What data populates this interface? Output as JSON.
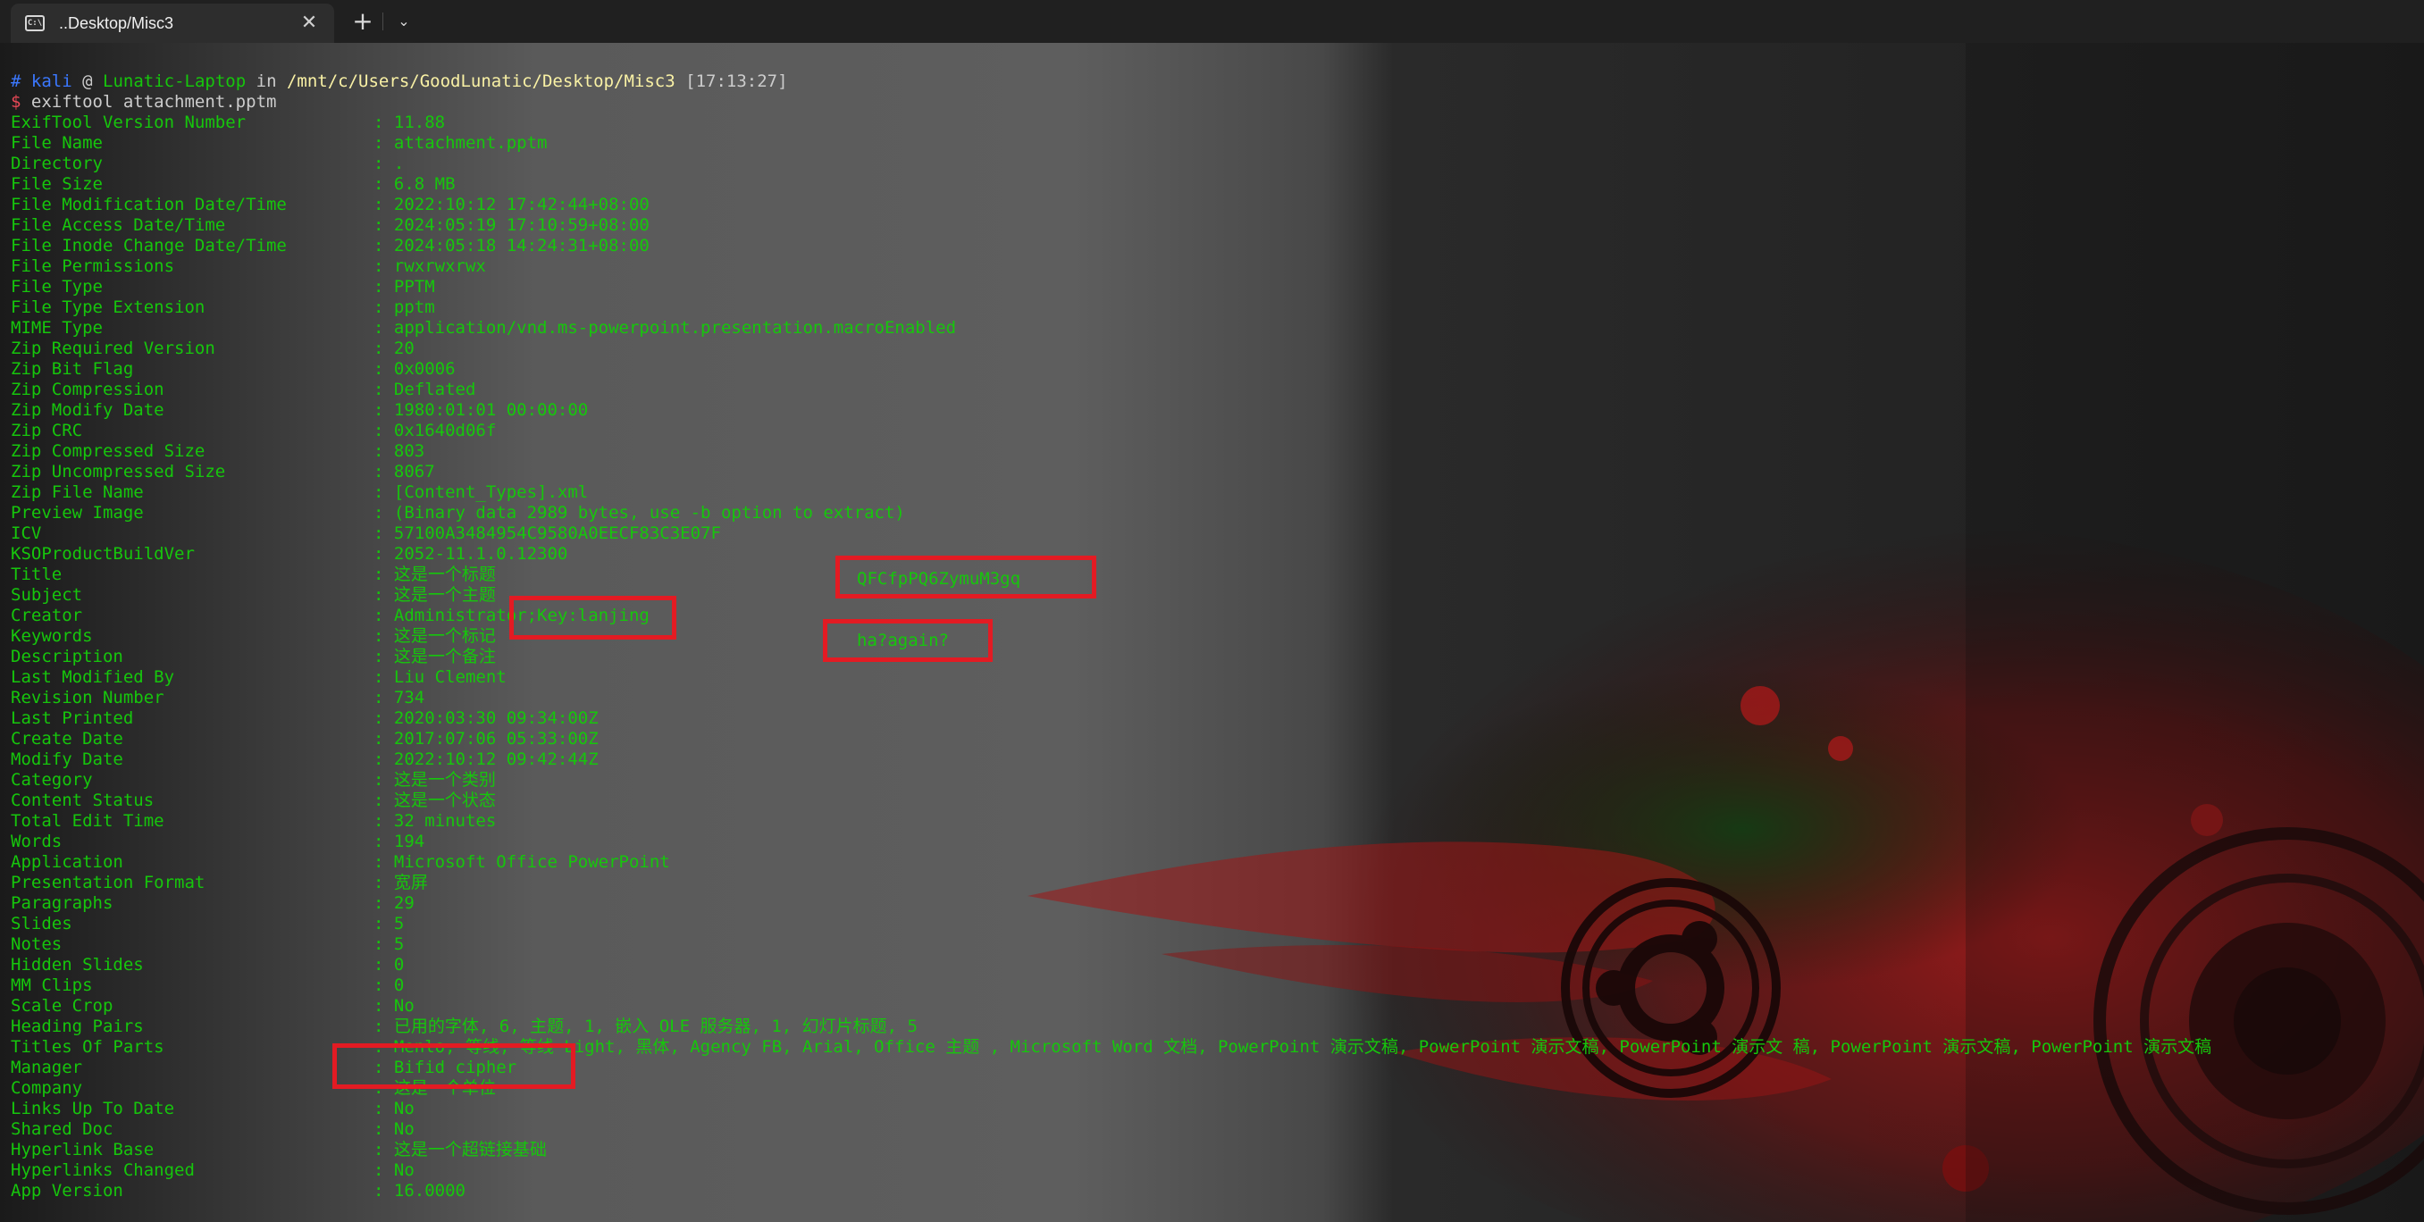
{
  "tab": {
    "title": "..Desktop/Misc3",
    "icon": "terminal-icon",
    "close_glyph": "✕",
    "new_tab_glyph": "+",
    "dropdown_glyph": "⌄"
  },
  "prompt": {
    "hash": "#",
    "user": "kali",
    "at": "@",
    "host": "Lunatic-Laptop",
    "in": "in",
    "path": "/mnt/c/Users/GoodLunatic/Desktop/Misc3",
    "time": "[17:13:27]",
    "dollar": "$",
    "command": "exiftool attachment.pptm"
  },
  "exif": [
    {
      "key": "ExifTool Version Number",
      "value": "11.88"
    },
    {
      "key": "File Name",
      "value": "attachment.pptm"
    },
    {
      "key": "Directory",
      "value": "."
    },
    {
      "key": "File Size",
      "value": "6.8 MB"
    },
    {
      "key": "File Modification Date/Time",
      "value": "2022:10:12 17:42:44+08:00"
    },
    {
      "key": "File Access Date/Time",
      "value": "2024:05:19 17:10:59+08:00"
    },
    {
      "key": "File Inode Change Date/Time",
      "value": "2024:05:18 14:24:31+08:00"
    },
    {
      "key": "File Permissions",
      "value": "rwxrwxrwx"
    },
    {
      "key": "File Type",
      "value": "PPTM"
    },
    {
      "key": "File Type Extension",
      "value": "pptm"
    },
    {
      "key": "MIME Type",
      "value": "application/vnd.ms-powerpoint.presentation.macroEnabled"
    },
    {
      "key": "Zip Required Version",
      "value": "20"
    },
    {
      "key": "Zip Bit Flag",
      "value": "0x0006"
    },
    {
      "key": "Zip Compression",
      "value": "Deflated"
    },
    {
      "key": "Zip Modify Date",
      "value": "1980:01:01 00:00:00"
    },
    {
      "key": "Zip CRC",
      "value": "0x1640d06f"
    },
    {
      "key": "Zip Compressed Size",
      "value": "803"
    },
    {
      "key": "Zip Uncompressed Size",
      "value": "8067"
    },
    {
      "key": "Zip File Name",
      "value": "[Content_Types].xml"
    },
    {
      "key": "Preview Image",
      "value": "(Binary data 2989 bytes, use -b option to extract)"
    },
    {
      "key": "ICV",
      "value": "57100A3484954C9580A0EECF83C3E07F"
    },
    {
      "key": "KSOProductBuildVer",
      "value": "2052-11.1.0.12300"
    },
    {
      "key": "Title",
      "value": "这是一个标题"
    },
    {
      "key": "Subject",
      "value": "这是一个主题"
    },
    {
      "key": "Creator",
      "value": "Administrator;Key:lanjing"
    },
    {
      "key": "Keywords",
      "value": "这是一个标记"
    },
    {
      "key": "Description",
      "value": "这是一个备注"
    },
    {
      "key": "Last Modified By",
      "value": "Liu Clement"
    },
    {
      "key": "Revision Number",
      "value": "734"
    },
    {
      "key": "Last Printed",
      "value": "2020:03:30 09:34:00Z"
    },
    {
      "key": "Create Date",
      "value": "2017:07:06 05:33:00Z"
    },
    {
      "key": "Modify Date",
      "value": "2022:10:12 09:42:44Z"
    },
    {
      "key": "Category",
      "value": "这是一个类别"
    },
    {
      "key": "Content Status",
      "value": "这是一个状态"
    },
    {
      "key": "Total Edit Time",
      "value": "32 minutes"
    },
    {
      "key": "Words",
      "value": "194"
    },
    {
      "key": "Application",
      "value": "Microsoft Office PowerPoint"
    },
    {
      "key": "Presentation Format",
      "value": "宽屏"
    },
    {
      "key": "Paragraphs",
      "value": "29"
    },
    {
      "key": "Slides",
      "value": "5"
    },
    {
      "key": "Notes",
      "value": "5"
    },
    {
      "key": "Hidden Slides",
      "value": "0"
    },
    {
      "key": "MM Clips",
      "value": "0"
    },
    {
      "key": "Scale Crop",
      "value": "No"
    },
    {
      "key": "Heading Pairs",
      "value": "已用的字体, 6, 主题, 1, 嵌入 OLE 服务器, 1, 幻灯片标题, 5"
    },
    {
      "key": "Titles Of Parts",
      "value": "Menlo, 等线, 等线 Light, 黑体, Agency FB, Arial, Office 主题 , Microsoft Word 文档, PowerPoint 演示文稿, PowerPoint 演示文稿, PowerPoint 演示文 稿, PowerPoint 演示文稿, PowerPoint 演示文稿"
    },
    {
      "key": "Manager",
      "value": "Bifid cipher"
    },
    {
      "key": "Company",
      "value": "这是一个单位"
    },
    {
      "key": "Links Up To Date",
      "value": "No"
    },
    {
      "key": "Shared Doc",
      "value": "No"
    },
    {
      "key": "Hyperlink Base",
      "value": "这是一个超链接基础"
    },
    {
      "key": "Hyperlinks Changed",
      "value": "No"
    },
    {
      "key": "App Version",
      "value": "16.0000"
    }
  ],
  "annotations": {
    "title_note": "QFCfpPQ6ZymuM3gq",
    "keywords_note": "ha?again?"
  },
  "colors": {
    "output_green": "#16c60c",
    "highlight_red": "#e31b23",
    "prompt_blue": "#3b78ff",
    "path_yellow": "#f9f1a5"
  }
}
